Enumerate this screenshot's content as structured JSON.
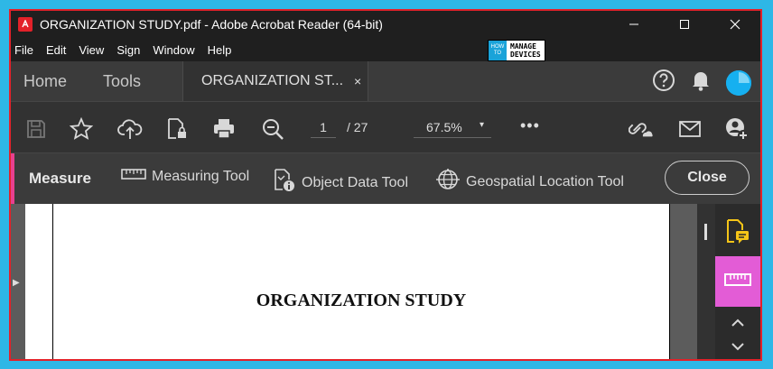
{
  "window": {
    "title": "ORGANIZATION STUDY.pdf - Adobe Acrobat Reader (64-bit)",
    "controls": {
      "minimize": "—",
      "maximize": "☐",
      "close": "✕"
    }
  },
  "menu": [
    "File",
    "Edit",
    "View",
    "Sign",
    "Window",
    "Help"
  ],
  "brand_logo": {
    "left": "HOW TO",
    "right_top": "MANAGE",
    "right_bottom": "DEVICES"
  },
  "tabs": {
    "home": "Home",
    "tools": "Tools",
    "document": "ORGANIZATION ST...",
    "document_close": "×"
  },
  "toolbar": {
    "page_current": "1",
    "page_total": "/ 27",
    "zoom": "67.5%",
    "zoom_caret": "▾",
    "more": "•••"
  },
  "measure_bar": {
    "title": "Measure",
    "tools": [
      "Measuring Tool",
      "Object Data Tool",
      "Geospatial Location Tool"
    ],
    "close_label": "Close"
  },
  "document": {
    "heading": "ORGANIZATION STUDY"
  },
  "colors": {
    "accent_pink": "#e8408f",
    "panel_active": "#e35cd6",
    "avatar": "#16b0f0",
    "border_red": "#e32129",
    "comment_yellow": "#f5c518"
  }
}
